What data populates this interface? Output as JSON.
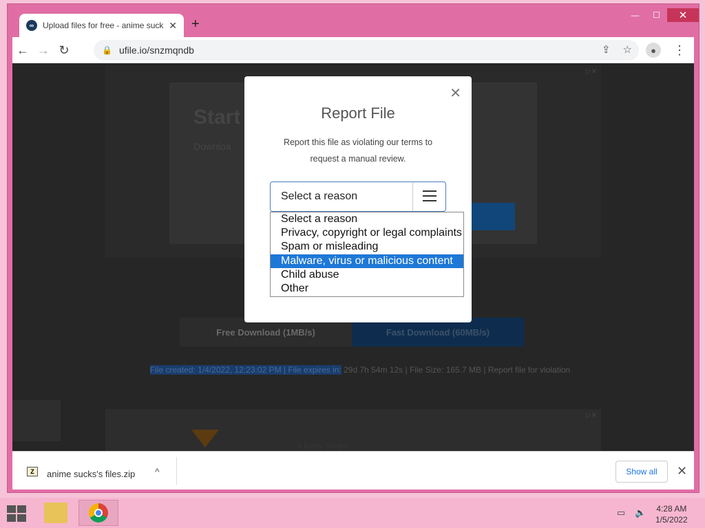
{
  "browser": {
    "tab_title": "Upload files for free - anime suck",
    "tab_close": "✕",
    "new_tab": "+",
    "url": "ufile.io/snzmqndb",
    "win_min": "—",
    "win_max": "☐",
    "win_close": "✕"
  },
  "page": {
    "ad_heading": "Start",
    "ad_sub": "Downloa",
    "free_download": "Free Download (1MB/s)",
    "fast_download": "Fast Download (60MB/s)",
    "meta_created": "File created: 1/4/2022, 12:23:02 PM",
    "meta_sep1": " | ",
    "meta_expires": "File expires in:",
    "meta_expires_val": " 29d 7h 54m 12s",
    "meta_sep2": " | ",
    "meta_size": "File Size: 165.7 MB",
    "meta_sep3": " | ",
    "meta_report": "Report file for violation",
    "bottom_ad_text": "3 Easy Steps:"
  },
  "modal": {
    "close": "✕",
    "title": "Report File",
    "description": "Report this file as violating our terms to request a manual review.",
    "select_value": "Select a reason",
    "options": [
      "Select a reason",
      "Privacy, copyright or legal complaints",
      "Spam or misleading",
      "Malware, virus or malicious content",
      "Child abuse",
      "Other"
    ],
    "highlighted_option_index": 3
  },
  "downloads": {
    "file_name": "anime sucks's files.zip",
    "file_icon_label": "Z",
    "chevron": "^",
    "show_all": "Show all",
    "close": "✕"
  },
  "taskbar": {
    "time": "4:28 AM",
    "date": "1/5/2022"
  },
  "colors": {
    "window_frame": "#e06ea4",
    "accent_blue": "#1e78d7",
    "link_blue": "#1a73e8"
  }
}
